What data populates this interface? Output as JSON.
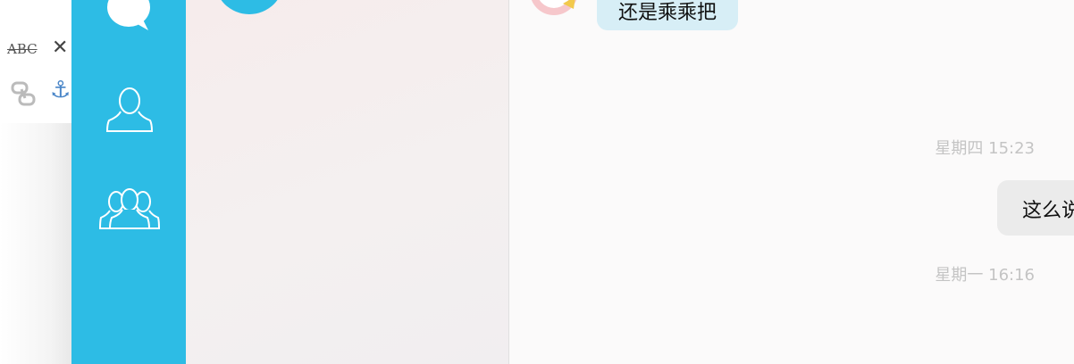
{
  "editor_toolbar": {
    "strikethrough_label": "ABC",
    "close_glyph": "✕",
    "anchor_glyph": "⚓",
    "icons": [
      "strikethrough-icon",
      "close-icon",
      "link-icon",
      "anchor-icon"
    ]
  },
  "sidebar": {
    "color": "#2dbce5",
    "items": [
      {
        "icon": "chat-bubble-icon"
      },
      {
        "icon": "person-icon"
      },
      {
        "icon": "group-icon"
      }
    ]
  },
  "chat": {
    "messages": [
      {
        "direction": "received",
        "text": "还是乘乘把",
        "avatar": "contact-avatar"
      },
      {
        "timestamp": "星期四  15:23"
      },
      {
        "direction": "sent",
        "text": "这么说"
      },
      {
        "timestamp": "星期一  16:16"
      }
    ]
  },
  "colors": {
    "received_bubble": "#d7eef6",
    "sent_bubble": "#ebebeb",
    "timestamp": "#c4c4c4"
  }
}
